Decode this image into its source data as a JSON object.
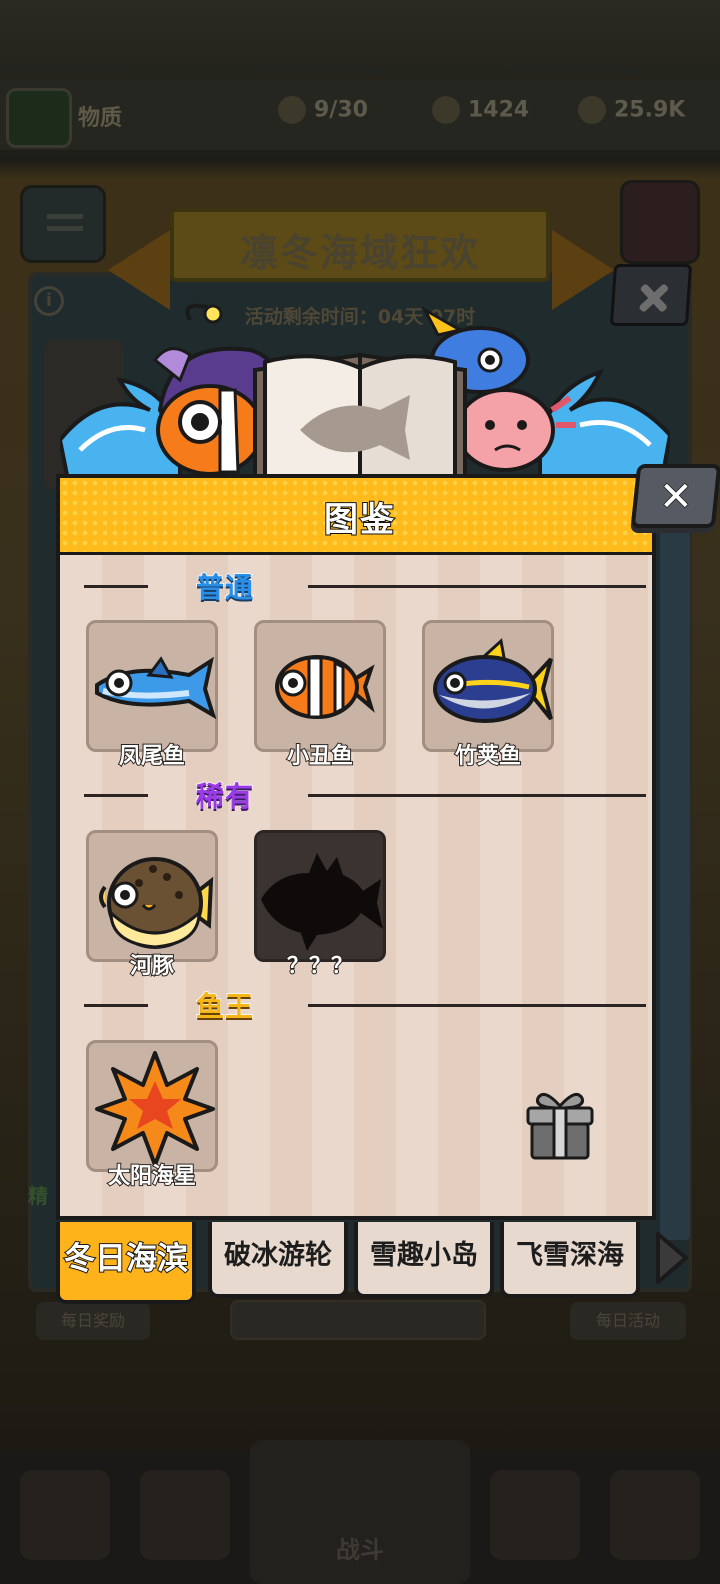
{
  "background": {
    "top_name": "物质",
    "stats": [
      {
        "icon": "fish-icon",
        "value": "9/30"
      },
      {
        "icon": "gem-icon",
        "value": "1424"
      },
      {
        "icon": "coin-icon",
        "value": "25.9K"
      }
    ],
    "event_title": "凛冬海域狂欢",
    "event_timer": "活动剩余时间：04天 07时",
    "side_green_text": "精",
    "bottom_left_label": "每日奖励",
    "bottom_right_label": "每日活动",
    "nav_center_label": "战斗"
  },
  "dialog": {
    "title": "图鉴",
    "sections": [
      {
        "label": "普通",
        "items": [
          {
            "name": "凤尾鱼",
            "locked": false,
            "icon": "anchovy-icon"
          },
          {
            "name": "小丑鱼",
            "locked": false,
            "icon": "clownfish-icon"
          },
          {
            "name": "竹荚鱼",
            "locked": false,
            "icon": "tuna-icon"
          }
        ]
      },
      {
        "label": "稀有",
        "items": [
          {
            "name": "河豚",
            "locked": false,
            "icon": "pufferfish-icon"
          },
          {
            "name": "？？？",
            "locked": true,
            "icon": "unknown-fish-silhouette-icon"
          }
        ]
      },
      {
        "label": "鱼王",
        "items": [
          {
            "name": "太阳海星",
            "locked": false,
            "icon": "sun-starfish-icon"
          }
        ]
      }
    ],
    "reward_icon": "gift-box-icon"
  },
  "tabs": [
    {
      "label": "冬日海滨",
      "active": true
    },
    {
      "label": "破冰游轮",
      "active": false
    },
    {
      "label": "雪趣小岛",
      "active": false
    },
    {
      "label": "飞雪深海",
      "active": false
    }
  ],
  "colors": {
    "header_yellow": "#ffbb1c",
    "tab_active": "#ffb31a",
    "common_label": "#2a8fe6",
    "rare_label": "#9a3be6",
    "king_label": "#f7b617",
    "card_bg": "#c8b3a5"
  }
}
